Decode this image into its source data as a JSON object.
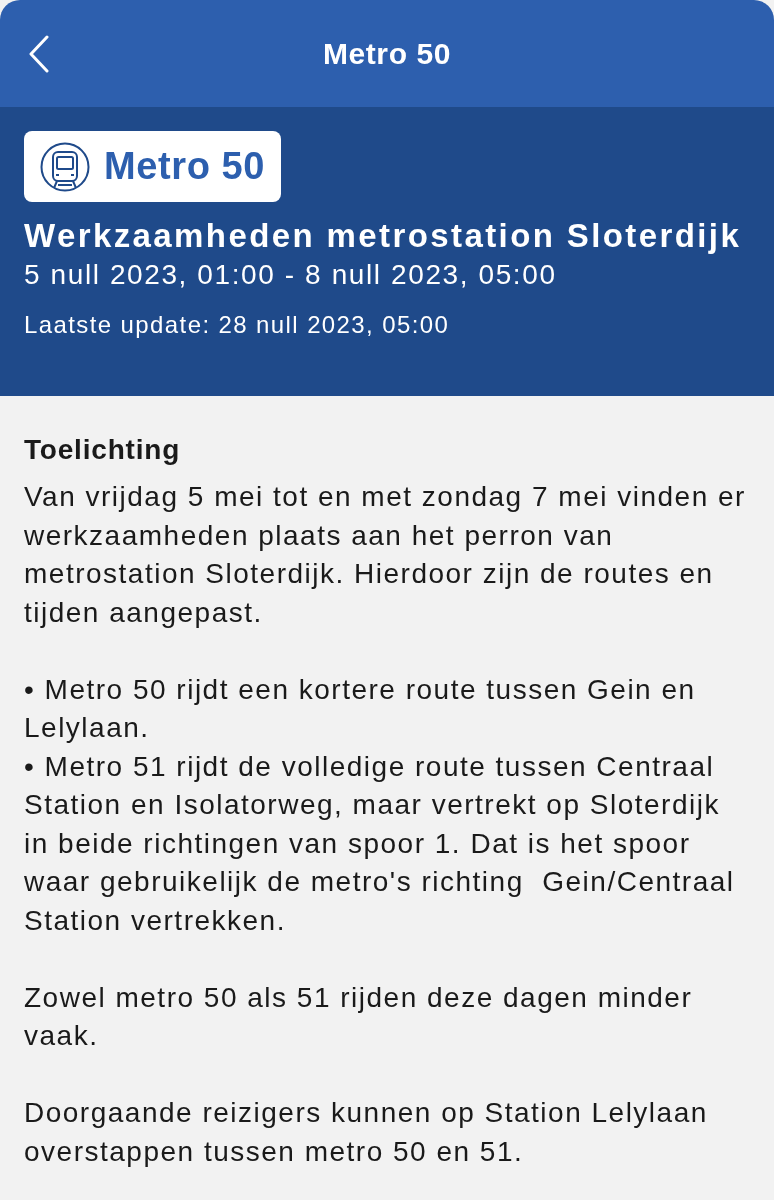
{
  "nav": {
    "title": "Metro 50"
  },
  "header": {
    "line_badge": "Metro 50",
    "title": "Werkzaamheden metrostation Sloterdijk",
    "period": "5 null 2023, 01:00 - 8 null 2023, 05:00",
    "last_update": "Laatste update: 28 null 2023, 05:00"
  },
  "explanation": {
    "heading": "Toelichting",
    "blocks": [
      {
        "lines": [
          "Van vrijdag 5 mei tot en met zondag 7 mei vinden er werkzaamheden plaats aan het perron van metrostation Sloterdijk. Hierdoor zijn de routes en tijden aangepast."
        ]
      },
      {
        "lines": [
          "• Metro 50 rijdt een kortere route tussen Gein en Lelylaan.",
          "• Metro 51 rijdt de volledige route tussen Centraal Station en Isolatorweg, maar vertrekt op Sloterdijk in beide richtingen van spoor 1. Dat is het spoor waar gebruikelijk de metro's richting  Gein/Centraal Station vertrekken."
        ]
      },
      {
        "lines": [
          "Zowel metro 50 als 51 rijden deze dagen minder vaak."
        ]
      },
      {
        "lines": [
          "Doorgaande reizigers kunnen op Station Lelylaan overstappen tussen metro 50 en 51."
        ]
      }
    ]
  }
}
